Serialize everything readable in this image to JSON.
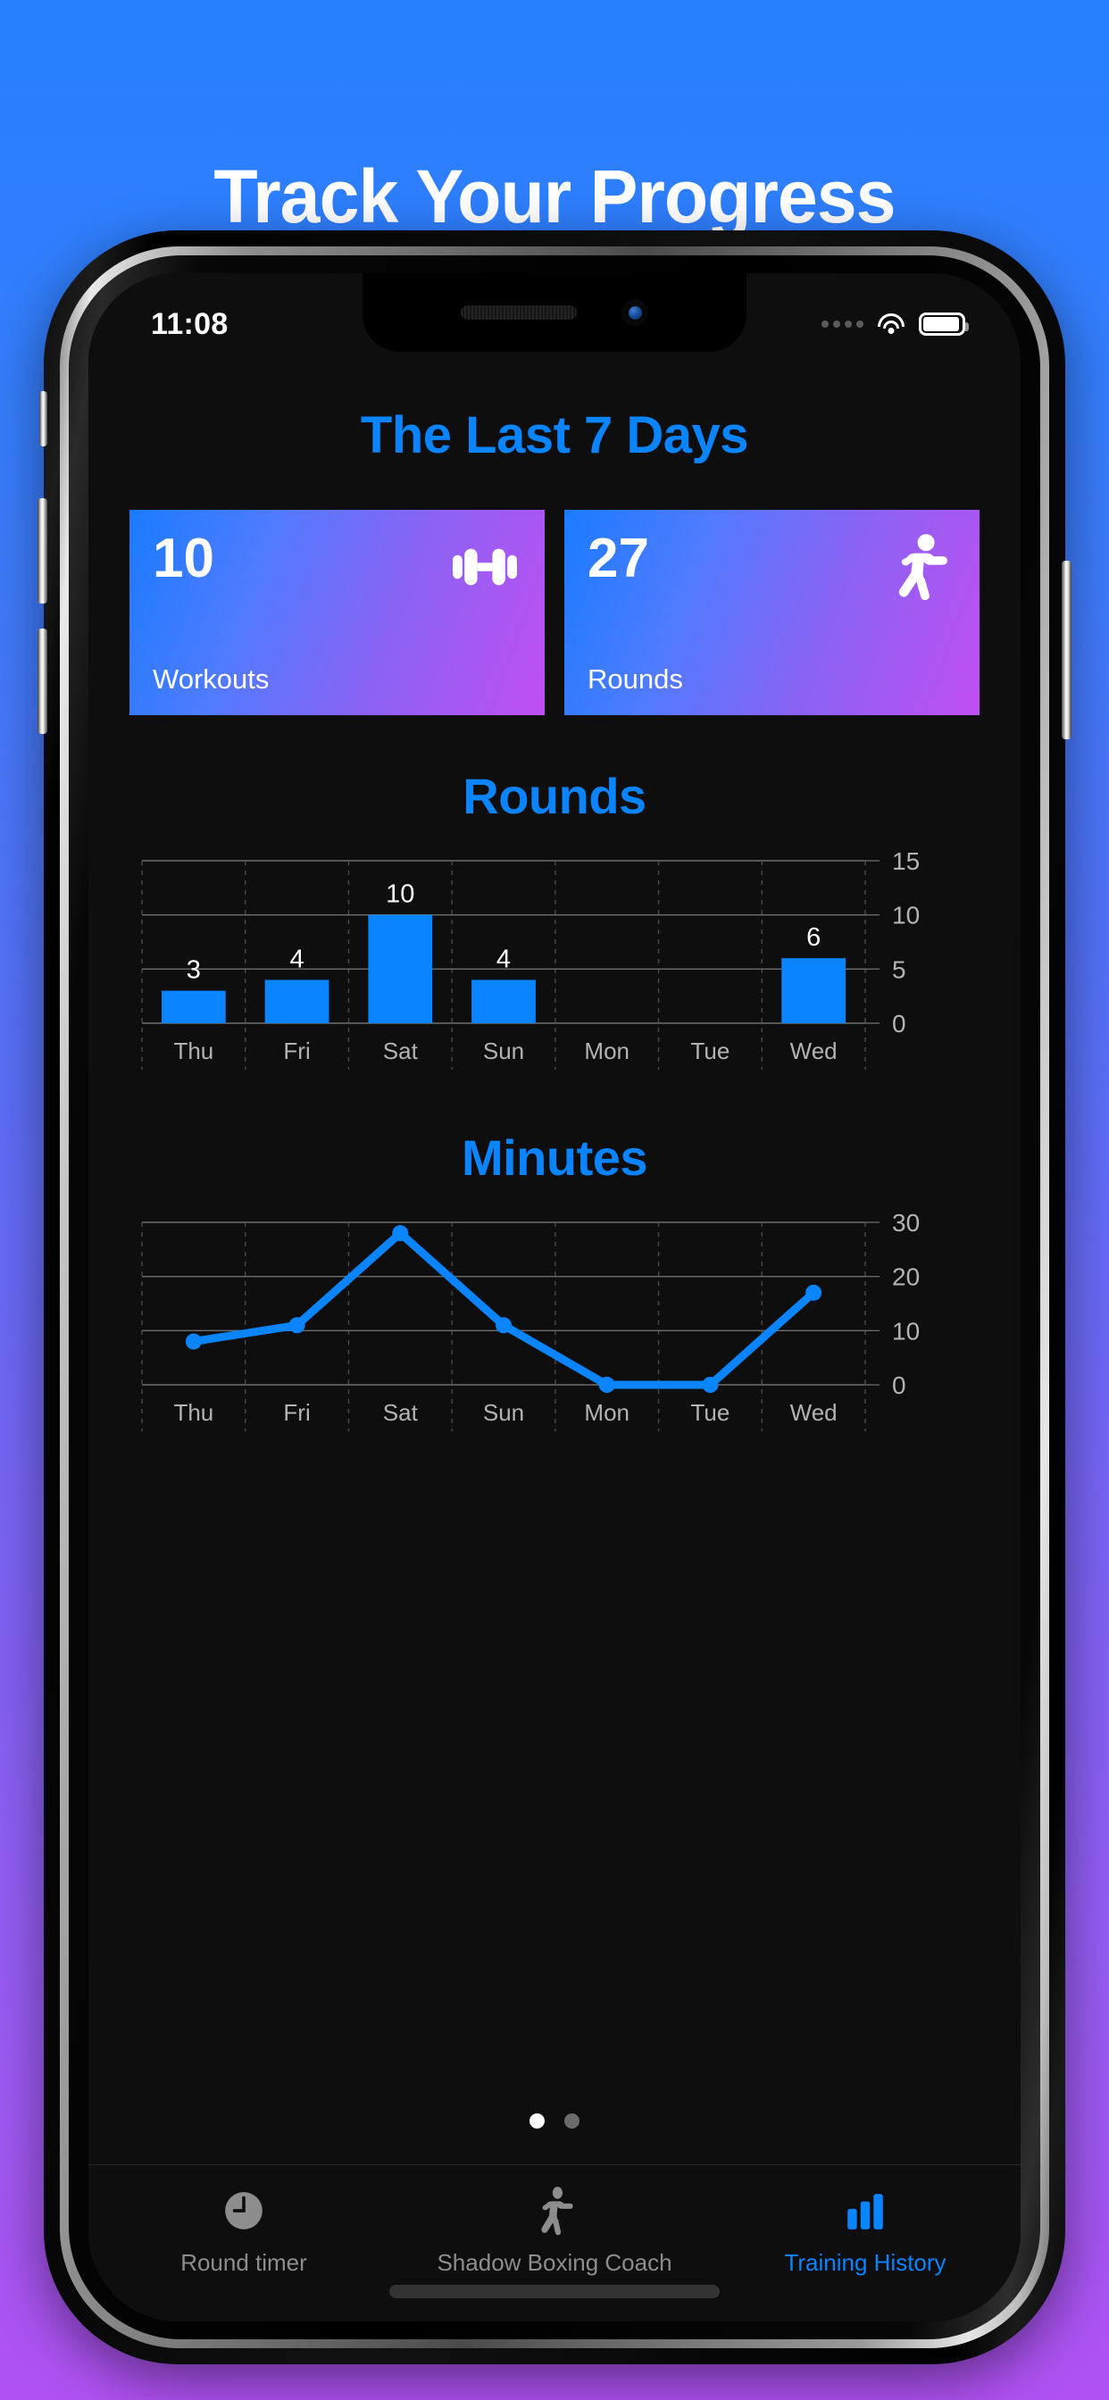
{
  "promo": {
    "headline": "Track Your Progress"
  },
  "theme": {
    "bg_top": "#2680ff",
    "bg_bottom": "#b052f3",
    "accent": "#0a84ff",
    "screen_bg": "#0e0e0e",
    "card_gradient_from": "#1a7bff",
    "card_gradient_to": "#c04ef0",
    "inactive_tab": "#8d8d8d"
  },
  "status_bar": {
    "time": "11:08",
    "signal_icon": "signal-dots-icon",
    "wifi_icon": "wifi-icon",
    "battery_icon": "battery-icon"
  },
  "screen": {
    "page_title": "The Last 7 Days",
    "stat_cards": [
      {
        "value": "10",
        "label": "Workouts",
        "icon": "dumbbell-icon"
      },
      {
        "value": "27",
        "label": "Rounds",
        "icon": "boxer-icon"
      }
    ],
    "page_dots": {
      "count": 2,
      "active_index": 0
    }
  },
  "chart_data": [
    {
      "type": "bar",
      "title": "Rounds",
      "categories": [
        "Thu",
        "Fri",
        "Sat",
        "Sun",
        "Mon",
        "Tue",
        "Wed"
      ],
      "values": [
        3,
        4,
        10,
        4,
        0,
        0,
        6
      ],
      "data_labels": [
        "3",
        "4",
        "10",
        "4",
        "",
        "",
        "6"
      ],
      "xlabel": "",
      "ylabel": "",
      "ylim": [
        0,
        15
      ],
      "yticks": [
        0,
        5,
        10,
        15
      ],
      "ytick_labels": [
        "0",
        "5",
        "10",
        "15"
      ],
      "grid": true,
      "bar_color": "#0a84ff",
      "legend": "none"
    },
    {
      "type": "line",
      "title": "Minutes",
      "categories": [
        "Thu",
        "Fri",
        "Sat",
        "Sun",
        "Mon",
        "Tue",
        "Wed"
      ],
      "values": [
        8,
        11,
        28,
        11,
        0,
        0,
        17
      ],
      "xlabel": "",
      "ylabel": "",
      "ylim": [
        0,
        30
      ],
      "yticks": [
        0,
        10,
        20,
        30
      ],
      "ytick_labels": [
        "0",
        "10",
        "20",
        "30"
      ],
      "grid": true,
      "line_color": "#0a84ff",
      "marker": "circle",
      "legend": "none"
    }
  ],
  "tabbar": {
    "tabs": [
      {
        "label": "Round timer",
        "icon": "clock-icon",
        "active": false
      },
      {
        "label": "Shadow Boxing Coach",
        "icon": "boxer-icon",
        "active": false
      },
      {
        "label": "Training History",
        "icon": "bar-chart-icon",
        "active": true
      }
    ]
  }
}
